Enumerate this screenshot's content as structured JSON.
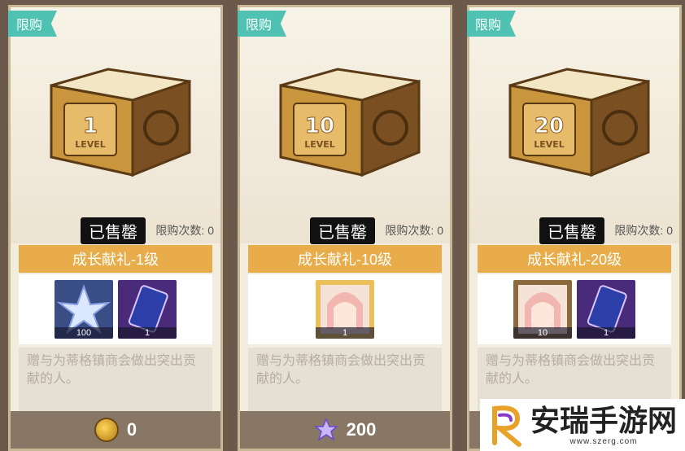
{
  "cards": [
    {
      "tag": "限购",
      "level": "1",
      "level_word": "LEVEL",
      "sold": "已售罄",
      "limit": "限购次数: 0",
      "title": "成长献礼-1级",
      "items": [
        {
          "count": "100",
          "icon": "crystal-star-icon"
        },
        {
          "count": "1",
          "icon": "ticket-card-icon"
        }
      ],
      "desc": "赠与为蒂格镇商会做出突出贡献的人。",
      "price": "0",
      "price_icon": "gold-coin-icon"
    },
    {
      "tag": "限购",
      "level": "10",
      "level_word": "LEVEL",
      "sold": "已售罄",
      "limit": "限购次数: 0",
      "title": "成长献礼-10级",
      "items": [
        {
          "count": "1",
          "icon": "character-portrait-icon"
        }
      ],
      "desc": "赠与为蒂格镇商会做出突出贡献的人。",
      "price": "200",
      "price_icon": "crystal-star-icon"
    },
    {
      "tag": "限购",
      "level": "20",
      "level_word": "LEVEL",
      "sold": "已售罄",
      "limit": "限购次数: 0",
      "title": "成长献礼-20级",
      "items": [
        {
          "count": "10",
          "icon": "character-portrait-icon"
        },
        {
          "count": "1",
          "icon": "ticket-card-icon"
        }
      ],
      "desc": "赠与为蒂格镇商会做出突出贡献的人。",
      "price": "",
      "price_icon": ""
    }
  ],
  "watermark": {
    "text": "安瑞手游网",
    "url": "www.szerg.com"
  }
}
